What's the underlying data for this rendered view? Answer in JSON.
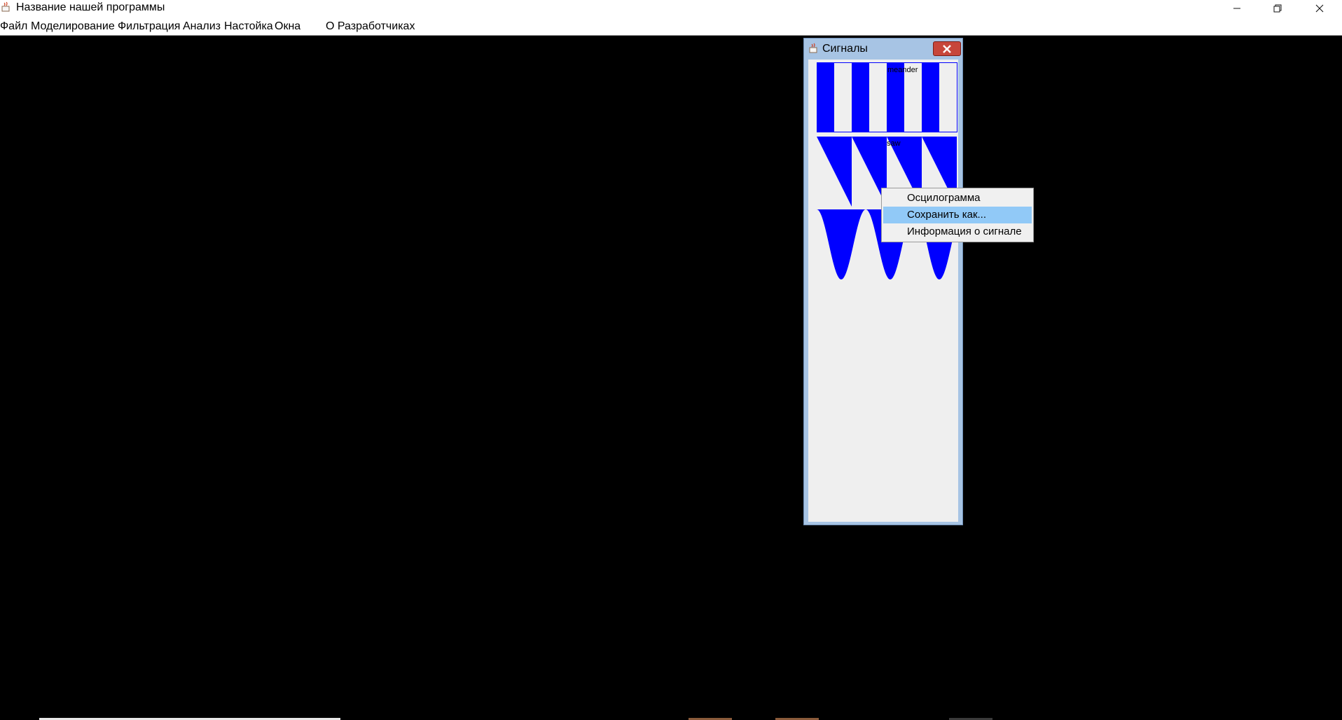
{
  "app": {
    "title": "Название нашей программы"
  },
  "menubar": {
    "items": [
      "Файл",
      "Моделирование",
      "Фильтрация",
      "Анализ",
      "Настойка",
      "Окна",
      "О Разработчиках"
    ]
  },
  "signals_window": {
    "title": "Сигналы",
    "panels": [
      {
        "label": "meander",
        "type": "square-wave",
        "color": "#0000ff"
      },
      {
        "label": "saw",
        "type": "sawtooth-wave",
        "color": "#0000ff"
      },
      {
        "label": "",
        "type": "sine-wave",
        "color": "#0000ff"
      }
    ]
  },
  "context_menu": {
    "items": [
      {
        "label": "Осцилограмма",
        "highlighted": false
      },
      {
        "label": "Сохранить как...",
        "highlighted": true
      },
      {
        "label": "Информация о сигнале",
        "highlighted": false
      }
    ]
  },
  "colors": {
    "signal": "#0000ff",
    "highlight": "#91c9f7",
    "desktop": "#000000"
  }
}
